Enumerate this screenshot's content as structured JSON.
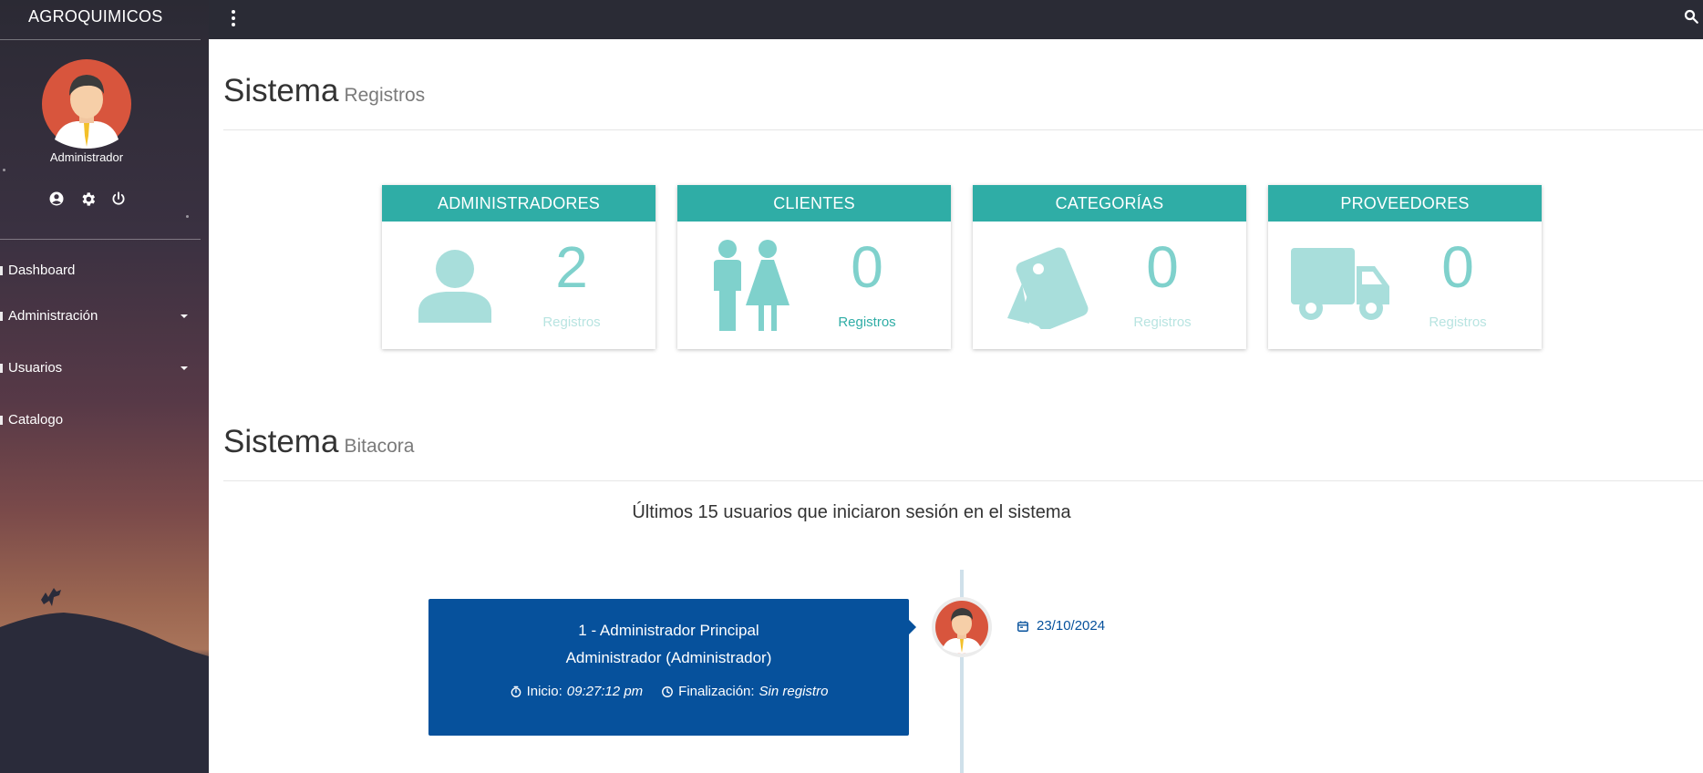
{
  "app": {
    "title": "AGROQUIMICOS"
  },
  "user": {
    "name": "Administrador"
  },
  "sidebar": {
    "icons": [
      "account-circle-icon",
      "gear-icon",
      "power-icon"
    ],
    "items": [
      {
        "label": "Dashboard",
        "has_submenu": false
      },
      {
        "label": "Administración",
        "has_submenu": true
      },
      {
        "label": "Usuarios",
        "has_submenu": true
      },
      {
        "label": "Catalogo",
        "has_submenu": false
      }
    ]
  },
  "topbar": {
    "menu_icon": "more-vert-icon",
    "search_icon": "search-icon"
  },
  "sections": {
    "registros": {
      "title": "Sistema",
      "subtitle": "Registros"
    },
    "bitacora": {
      "title": "Sistema",
      "subtitle": "Bitacora",
      "caption": "Últimos 15 usuarios que iniciaron sesión en el sistema"
    }
  },
  "cards": [
    {
      "title": "ADMINISTRADORES",
      "value": "2",
      "label": "Registros",
      "icon": "person-icon"
    },
    {
      "title": "CLIENTES",
      "value": "0",
      "label": "Registros",
      "icon": "man-woman-icon"
    },
    {
      "title": "CATEGORÍAS",
      "value": "0",
      "label": "Registros",
      "icon": "tags-icon"
    },
    {
      "title": "PROVEEDORES",
      "value": "0",
      "label": "Registros",
      "icon": "truck-icon"
    }
  ],
  "timeline": [
    {
      "line1": "1 - Administrador Principal",
      "line2": "Administrador (Administrador)",
      "start_label": "Inicio:",
      "start_value": "09:27:12 pm",
      "end_label": "Finalización:",
      "end_value": "Sin registro",
      "date": "23/10/2024"
    }
  ],
  "colors": {
    "accent": "#2fada6",
    "timeline_card": "#06519c",
    "topbar": "#2a2b35"
  }
}
